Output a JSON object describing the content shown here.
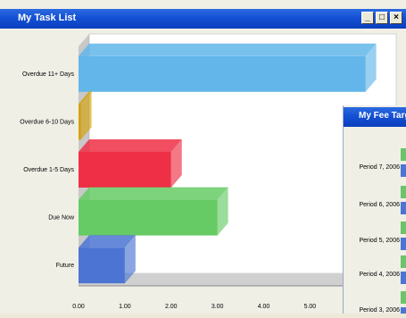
{
  "window": {
    "title": "My Task List",
    "controls": {
      "minimize": "_",
      "maximize": "□",
      "close": "×"
    }
  },
  "chart_data": {
    "type": "bar",
    "orientation": "horizontal",
    "categories": [
      "Overdue 11+ Days",
      "Overdue 6-10 Days",
      "Overdue 1-5 Days",
      "Due Now",
      "Future"
    ],
    "values": [
      6.2,
      0.05,
      2.0,
      3.0,
      1.0
    ],
    "colors": [
      "#62b6ea",
      "#d4a10a",
      "#ee2f45",
      "#66cb64",
      "#4c74d2"
    ],
    "xticks": [
      "0.00",
      "1.00",
      "2.00",
      "3.00",
      "4.00",
      "5.00"
    ],
    "xlim": [
      0,
      6.4
    ]
  },
  "subwindow": {
    "title": "My Fee Targ",
    "labels": [
      "Period 7, 2006",
      "Period 6, 2006",
      "Period 5, 2006",
      "Period 4, 2006",
      "Period 3, 2006"
    ]
  }
}
